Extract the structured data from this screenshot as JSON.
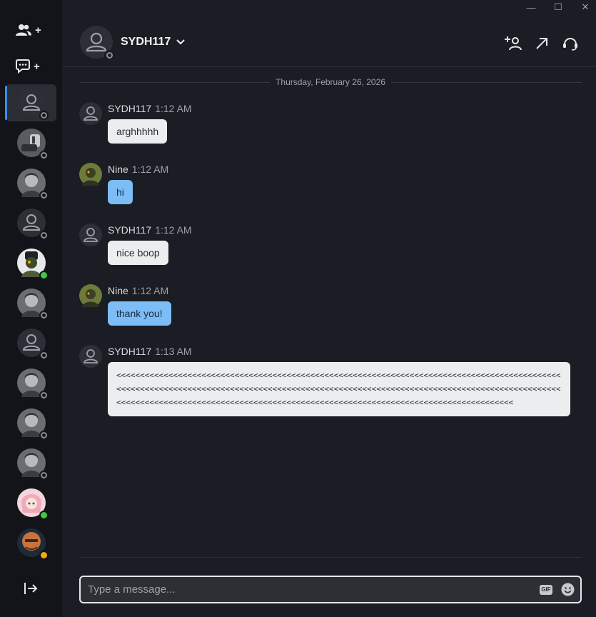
{
  "window": {
    "controls": [
      {
        "name": "minimize",
        "glyph": "—"
      },
      {
        "name": "maximize",
        "glyph": "☐"
      },
      {
        "name": "close",
        "glyph": "✕"
      }
    ]
  },
  "sidebar": {
    "actions": [
      {
        "name": "add-friend",
        "icon": "people-icon",
        "plus": "+"
      },
      {
        "name": "new-chat",
        "icon": "chat-bubble-icon",
        "plus": "+"
      }
    ],
    "contacts": [
      {
        "avatar": "default",
        "status": "offline",
        "active": true
      },
      {
        "avatar": "gray-robot",
        "status": "offline"
      },
      {
        "avatar": "gray-portrait",
        "status": "offline"
      },
      {
        "avatar": "default",
        "status": "offline"
      },
      {
        "avatar": "green-helmet",
        "status": "online"
      },
      {
        "avatar": "gray-portrait",
        "status": "offline"
      },
      {
        "avatar": "default",
        "status": "offline"
      },
      {
        "avatar": "gray-portrait",
        "status": "offline"
      },
      {
        "avatar": "gray-portrait",
        "status": "offline"
      },
      {
        "avatar": "gray-portrait",
        "status": "offline"
      },
      {
        "avatar": "pink-anime",
        "status": "online"
      },
      {
        "avatar": "orange-bald",
        "status": "away"
      }
    ]
  },
  "header": {
    "name": "SYDH117",
    "status": "offline",
    "buttons": [
      "add-person-icon",
      "expand-arrow-icon",
      "headset-icon"
    ]
  },
  "chat": {
    "date_separator": "Thursday, February 26, 2026",
    "messages": [
      {
        "sender": "SYDH117",
        "time": "1:12 AM",
        "text": "arghhhhh",
        "side": "them"
      },
      {
        "sender": "Nine",
        "time": "1:12 AM",
        "text": "hi",
        "side": "me"
      },
      {
        "sender": "SYDH117",
        "time": "1:12 AM",
        "text": "nice boop",
        "side": "them"
      },
      {
        "sender": "Nine",
        "time": "1:12 AM",
        "text": "thank you!",
        "side": "me"
      },
      {
        "sender": "SYDH117",
        "time": "1:13 AM",
        "text": "<<<<<<<<<<<<<<<<<<<<<<<<<<<<<<<<<<<<<<<<<<<<<<<<<<<<<<<<<<<<<<<<<<<<<<<<<<<<<<<<<<<<<<<<<<<<<<<<<<<<<<<<<<<<<<<<<<<<<<<<<<<<<<<<<<<<<<<<<<<<<<<<<<<<<<<<<<<<<<<<<<<<<<<<<<<<<<<<<<<<<<<<<<<<<<<<<<<<<<<<<<<<<<<<<<<<<<<<<<<<<<<<<<<<<<<<<<<<<<<<<<<<<<<<<<<<<<<<<<<<<<<<<<<<<<<<",
        "side": "them"
      }
    ]
  },
  "composer": {
    "placeholder": "Type a message...",
    "gif_label": "GIF"
  },
  "colors": {
    "background": "#1a1d23",
    "sidebar": "#121419",
    "accent": "#3b8cf0",
    "my_bubble": "#7cbcf7",
    "their_bubble": "#ecedef",
    "online": "#3ec93e",
    "away": "#f2a91a"
  }
}
